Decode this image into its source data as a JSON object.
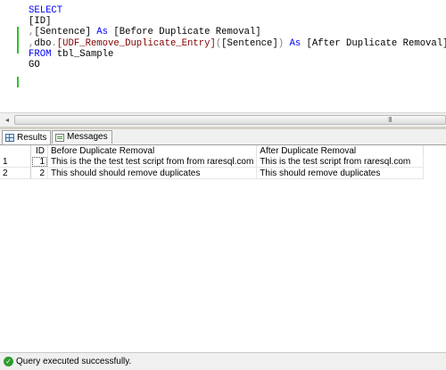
{
  "editor": {
    "lines": [
      {
        "parts": [
          {
            "t": "SELECT",
            "c": "kw"
          }
        ]
      },
      {
        "parts": [
          {
            "t": "[ID]",
            "c": ""
          }
        ]
      },
      {
        "parts": [
          {
            "t": ",",
            "c": "gr"
          },
          {
            "t": "[Sentence] ",
            "c": ""
          },
          {
            "t": "As",
            "c": "kw"
          },
          {
            "t": " [Before Duplicate Removal]",
            "c": ""
          }
        ]
      },
      {
        "parts": [
          {
            "t": ",",
            "c": "gr"
          },
          {
            "t": "dbo",
            "c": ""
          },
          {
            "t": ".",
            "c": "gr"
          },
          {
            "t": "[UDF_Remove_Duplicate_Entry]",
            "c": "br"
          },
          {
            "t": "(",
            "c": "gr"
          },
          {
            "t": "[Sentence]",
            "c": ""
          },
          {
            "t": ")",
            "c": "gr"
          },
          {
            "t": " ",
            "c": ""
          },
          {
            "t": "As",
            "c": "kw"
          },
          {
            "t": " [After Duplicate Removal]",
            "c": ""
          }
        ]
      },
      {
        "parts": [
          {
            "t": "FROM",
            "c": "kw"
          },
          {
            "t": " tbl_Sample",
            "c": ""
          }
        ]
      },
      {
        "parts": [
          {
            "t": "GO",
            "c": ""
          }
        ]
      }
    ]
  },
  "scrollbar": {
    "left_arrow": "◂",
    "grip": "III"
  },
  "tabs": [
    {
      "label": "Results",
      "icon": "grid-icon",
      "active": true
    },
    {
      "label": "Messages",
      "icon": "messages-icon",
      "active": false
    }
  ],
  "results": {
    "columns": [
      "",
      "ID",
      "Before Duplicate Removal",
      "After Duplicate Removal"
    ],
    "rows": [
      {
        "rownum": "1",
        "id": "1",
        "before": "This is the the test test script from from raresql.com",
        "after": "This is the test script from raresql.com"
      },
      {
        "rownum": "2",
        "id": "2",
        "before": "This should should remove duplicates",
        "after": "This should remove duplicates"
      }
    ]
  },
  "status": {
    "text": "Query executed successfully.",
    "icon": "check-icon"
  }
}
